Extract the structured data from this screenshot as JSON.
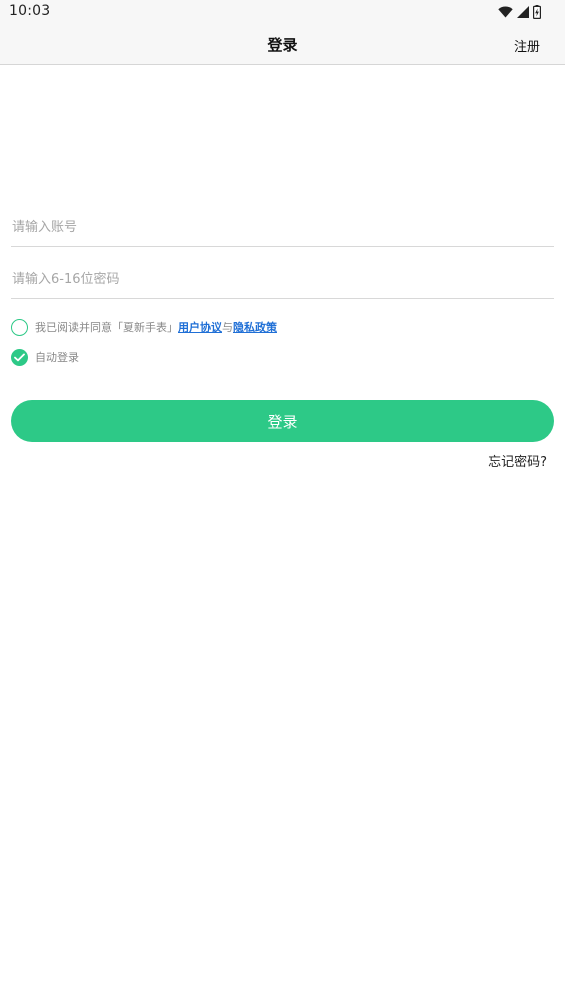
{
  "status_bar": {
    "time": "10:03",
    "icons": [
      "wifi-icon",
      "cell-signal-icon",
      "battery-icon"
    ]
  },
  "nav": {
    "title": "登录",
    "register_label": "注册"
  },
  "form": {
    "account_placeholder": "请输入账号",
    "account_value": "",
    "password_placeholder": "请输入6-16位密码",
    "password_value": ""
  },
  "agreement": {
    "checked": false,
    "prefix": "我已阅读并同意「夏新手表」",
    "user_agreement": "用户协议",
    "connector": "与",
    "privacy_policy": "隐私政策"
  },
  "auto_login": {
    "checked": true,
    "label": "自动登录"
  },
  "login_button_label": "登录",
  "forgot_password_label": "忘记密码?",
  "colors": {
    "accent": "#2dc987",
    "link": "#1f6fd6",
    "bar_background": "#f7f7f7"
  }
}
